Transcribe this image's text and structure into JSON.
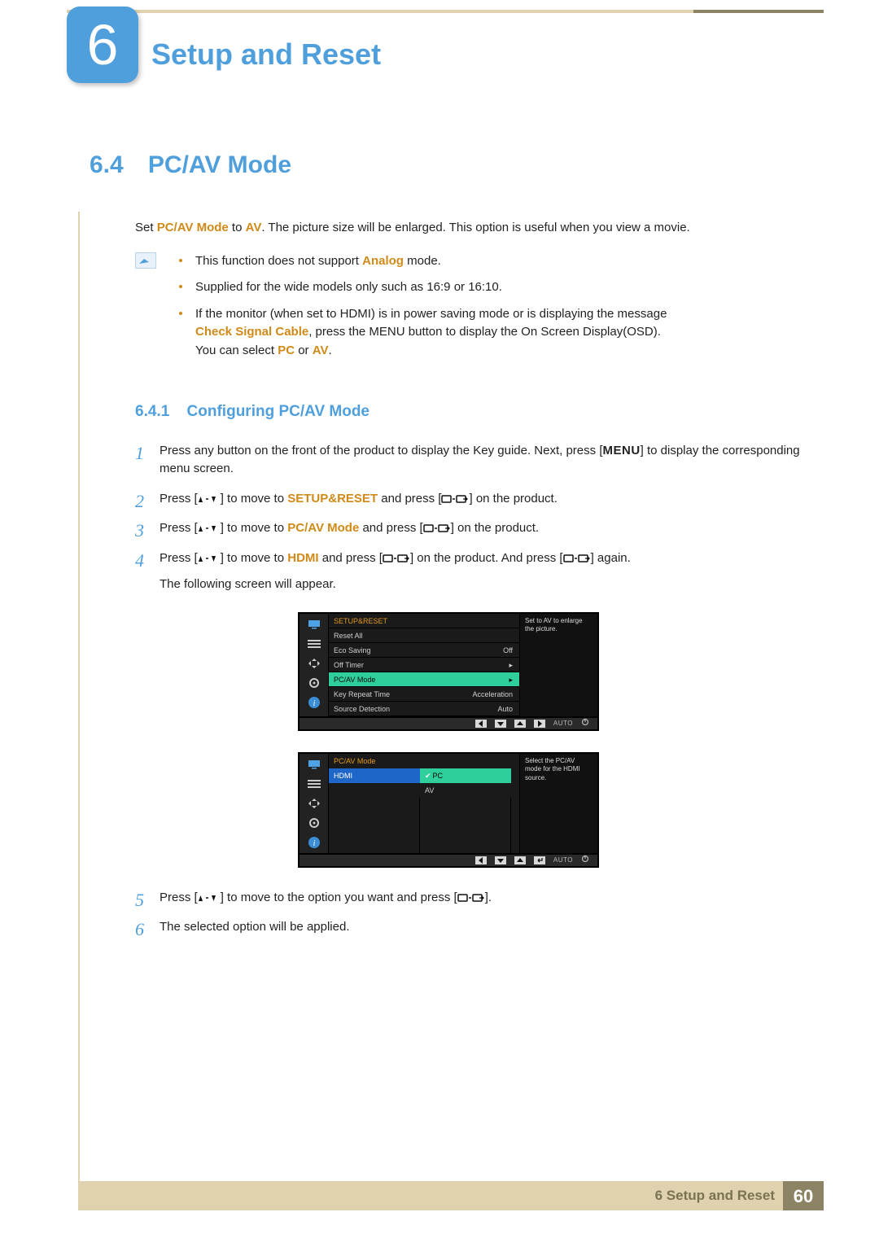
{
  "chapter": {
    "number": "6",
    "title": "Setup and Reset"
  },
  "section": {
    "number": "6.4",
    "title": "PC/AV Mode"
  },
  "intro": {
    "pre": "Set ",
    "mode": "PC/AV Mode",
    "mid": " to ",
    "av": "AV",
    "post": ". The picture size will be enlarged. This option is useful when you view a movie."
  },
  "notes": {
    "n1_pre": "This function does not support ",
    "n1_hl": "Analog",
    "n1_post": " mode.",
    "n2": "Supplied for the wide models only such as 16:9 or 16:10.",
    "n3_l1": "If the monitor (when set to HDMI) is in power saving mode or is displaying the message",
    "n3_hl": "Check Signal Cable",
    "n3_l2": ", press the MENU button to display the On Screen Display(OSD).",
    "n3_l3_pre": "You can select ",
    "n3_pc": "PC",
    "n3_or": " or ",
    "n3_av": "AV",
    "n3_dot": "."
  },
  "subsection": {
    "number": "6.4.1",
    "title": "Configuring PC/AV Mode"
  },
  "steps": {
    "s1a": "Press any button on the front of the product to display the Key guide. Next, press [",
    "s1_menu": "MENU",
    "s1b": "] to display the corresponding menu screen.",
    "s2a": "Press [",
    "s2b": "] to move to ",
    "s2_hl": "SETUP&RESET",
    "s2c": " and press [",
    "s2d": "] on the product.",
    "s3a": "Press [",
    "s3b": "] to move to ",
    "s3_hl": "PC/AV Mode",
    "s3c": " and press [",
    "s3d": "] on the product.",
    "s4a": "Press [",
    "s4b": "] to move to ",
    "s4_hl": "HDMI",
    "s4c": " and press [",
    "s4d": "] on the product. And press [",
    "s4e": "] again.",
    "s4f": "The following screen will appear.",
    "s5a": "Press [",
    "s5b": "] to move to the option you want and press [",
    "s5c": "].",
    "s6": "The selected option will be applied."
  },
  "osd1": {
    "header": "SETUP&RESET",
    "help": "Set to AV to enlarge the picture.",
    "rows": [
      {
        "label": "Reset All",
        "value": ""
      },
      {
        "label": "Eco Saving",
        "value": "Off"
      },
      {
        "label": "Off Timer",
        "value": "▸"
      },
      {
        "label": "PC/AV Mode",
        "value": "▸",
        "selected": true
      },
      {
        "label": "Key Repeat Time",
        "value": "Acceleration"
      },
      {
        "label": "Source Detection",
        "value": "Auto"
      }
    ],
    "nav_auto": "AUTO"
  },
  "osd2": {
    "header": "PC/AV Mode",
    "help": "Select the PC/AV mode for the HDMI source.",
    "source": "HDMI",
    "options": [
      {
        "label": "PC",
        "selected": true
      },
      {
        "label": "AV",
        "selected": false
      }
    ],
    "nav_auto": "AUTO"
  },
  "footer": {
    "label": "6 Setup and Reset",
    "page": "60"
  }
}
